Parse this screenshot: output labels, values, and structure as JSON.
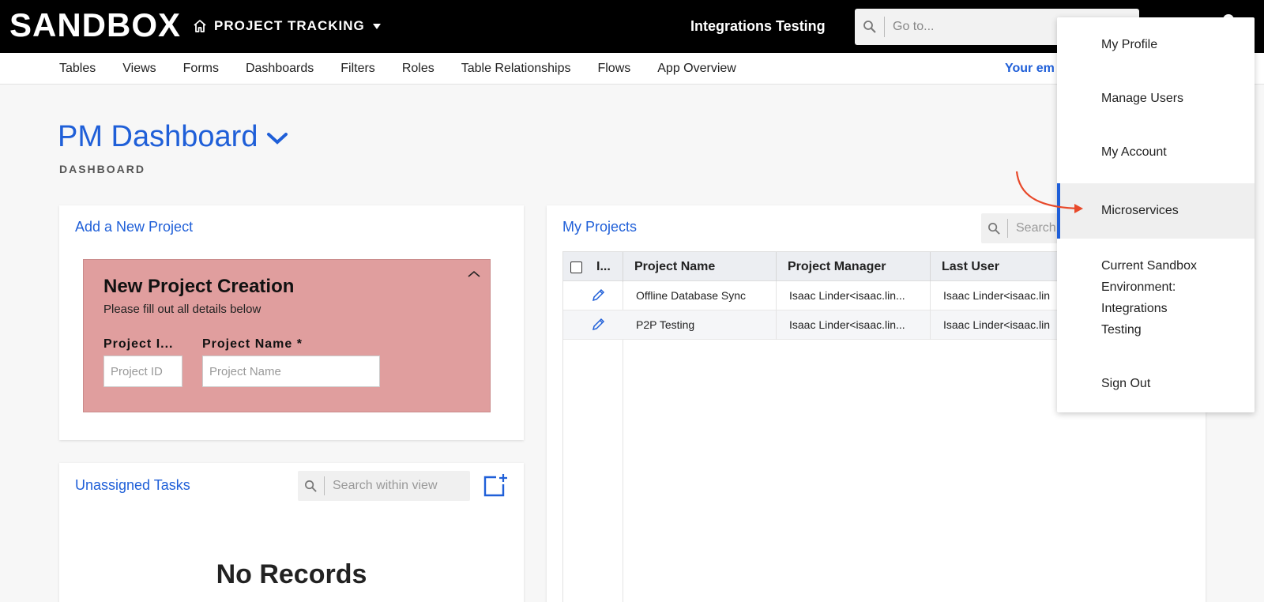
{
  "topbar": {
    "logo": "SANDBOX",
    "app_name": "PROJECT TRACKING",
    "env_title": "Integrations Testing",
    "goto_placeholder": "Go to..."
  },
  "nav": {
    "items": [
      "Tables",
      "Views",
      "Forms",
      "Dashboards",
      "Filters",
      "Roles",
      "Table Relationships",
      "Flows",
      "App Overview"
    ],
    "email_text": "Your em"
  },
  "page": {
    "title": "PM Dashboard",
    "subtitle": "DASHBOARD"
  },
  "add_project": {
    "card_title": "Add a New Project",
    "form_title": "New Project Creation",
    "form_desc": "Please fill out all details below",
    "project_id_label": "Project I...",
    "project_id_placeholder": "Project ID",
    "project_name_label": "Project Name *",
    "project_name_placeholder": "Project Name"
  },
  "unassigned": {
    "card_title": "Unassigned Tasks",
    "search_placeholder": "Search within view",
    "empty_text": "No Records"
  },
  "my_projects": {
    "card_title": "My Projects",
    "search_placeholder": "Search",
    "columns": [
      "I...",
      "Project Name",
      "Project Manager",
      "Last User"
    ],
    "rows": [
      {
        "project_name": "Offline Database Sync",
        "manager": "Isaac Linder<isaac.lin...",
        "last_user": "Isaac Linder<isaac.lin"
      },
      {
        "project_name": "P2P Testing",
        "manager": "Isaac Linder<isaac.lin...",
        "last_user": "Isaac Linder<isaac.lin"
      }
    ]
  },
  "user_menu": {
    "items": [
      "My Profile",
      "Manage Users",
      "My Account",
      "Microservices"
    ],
    "environment_lines": [
      "Current Sandbox",
      "Environment:",
      "Integrations",
      "Testing"
    ],
    "sign_out": "Sign Out",
    "active_item": "Microservices"
  },
  "colors": {
    "accent": "#1f5fd8",
    "form_panel": "#e09e9e",
    "annotation_arrow": "#e8492a"
  }
}
